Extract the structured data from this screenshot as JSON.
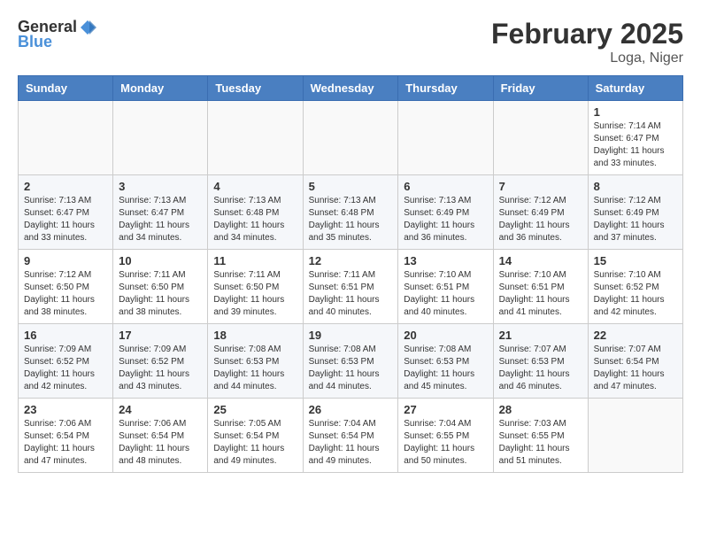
{
  "header": {
    "logo_general": "General",
    "logo_blue": "Blue",
    "month_title": "February 2025",
    "location": "Loga, Niger"
  },
  "weekdays": [
    "Sunday",
    "Monday",
    "Tuesday",
    "Wednesday",
    "Thursday",
    "Friday",
    "Saturday"
  ],
  "weeks": [
    [
      {
        "day": "",
        "info": ""
      },
      {
        "day": "",
        "info": ""
      },
      {
        "day": "",
        "info": ""
      },
      {
        "day": "",
        "info": ""
      },
      {
        "day": "",
        "info": ""
      },
      {
        "day": "",
        "info": ""
      },
      {
        "day": "1",
        "info": "Sunrise: 7:14 AM\nSunset: 6:47 PM\nDaylight: 11 hours and 33 minutes."
      }
    ],
    [
      {
        "day": "2",
        "info": "Sunrise: 7:13 AM\nSunset: 6:47 PM\nDaylight: 11 hours and 33 minutes."
      },
      {
        "day": "3",
        "info": "Sunrise: 7:13 AM\nSunset: 6:47 PM\nDaylight: 11 hours and 34 minutes."
      },
      {
        "day": "4",
        "info": "Sunrise: 7:13 AM\nSunset: 6:48 PM\nDaylight: 11 hours and 34 minutes."
      },
      {
        "day": "5",
        "info": "Sunrise: 7:13 AM\nSunset: 6:48 PM\nDaylight: 11 hours and 35 minutes."
      },
      {
        "day": "6",
        "info": "Sunrise: 7:13 AM\nSunset: 6:49 PM\nDaylight: 11 hours and 36 minutes."
      },
      {
        "day": "7",
        "info": "Sunrise: 7:12 AM\nSunset: 6:49 PM\nDaylight: 11 hours and 36 minutes."
      },
      {
        "day": "8",
        "info": "Sunrise: 7:12 AM\nSunset: 6:49 PM\nDaylight: 11 hours and 37 minutes."
      }
    ],
    [
      {
        "day": "9",
        "info": "Sunrise: 7:12 AM\nSunset: 6:50 PM\nDaylight: 11 hours and 38 minutes."
      },
      {
        "day": "10",
        "info": "Sunrise: 7:11 AM\nSunset: 6:50 PM\nDaylight: 11 hours and 38 minutes."
      },
      {
        "day": "11",
        "info": "Sunrise: 7:11 AM\nSunset: 6:50 PM\nDaylight: 11 hours and 39 minutes."
      },
      {
        "day": "12",
        "info": "Sunrise: 7:11 AM\nSunset: 6:51 PM\nDaylight: 11 hours and 40 minutes."
      },
      {
        "day": "13",
        "info": "Sunrise: 7:10 AM\nSunset: 6:51 PM\nDaylight: 11 hours and 40 minutes."
      },
      {
        "day": "14",
        "info": "Sunrise: 7:10 AM\nSunset: 6:51 PM\nDaylight: 11 hours and 41 minutes."
      },
      {
        "day": "15",
        "info": "Sunrise: 7:10 AM\nSunset: 6:52 PM\nDaylight: 11 hours and 42 minutes."
      }
    ],
    [
      {
        "day": "16",
        "info": "Sunrise: 7:09 AM\nSunset: 6:52 PM\nDaylight: 11 hours and 42 minutes."
      },
      {
        "day": "17",
        "info": "Sunrise: 7:09 AM\nSunset: 6:52 PM\nDaylight: 11 hours and 43 minutes."
      },
      {
        "day": "18",
        "info": "Sunrise: 7:08 AM\nSunset: 6:53 PM\nDaylight: 11 hours and 44 minutes."
      },
      {
        "day": "19",
        "info": "Sunrise: 7:08 AM\nSunset: 6:53 PM\nDaylight: 11 hours and 44 minutes."
      },
      {
        "day": "20",
        "info": "Sunrise: 7:08 AM\nSunset: 6:53 PM\nDaylight: 11 hours and 45 minutes."
      },
      {
        "day": "21",
        "info": "Sunrise: 7:07 AM\nSunset: 6:53 PM\nDaylight: 11 hours and 46 minutes."
      },
      {
        "day": "22",
        "info": "Sunrise: 7:07 AM\nSunset: 6:54 PM\nDaylight: 11 hours and 47 minutes."
      }
    ],
    [
      {
        "day": "23",
        "info": "Sunrise: 7:06 AM\nSunset: 6:54 PM\nDaylight: 11 hours and 47 minutes."
      },
      {
        "day": "24",
        "info": "Sunrise: 7:06 AM\nSunset: 6:54 PM\nDaylight: 11 hours and 48 minutes."
      },
      {
        "day": "25",
        "info": "Sunrise: 7:05 AM\nSunset: 6:54 PM\nDaylight: 11 hours and 49 minutes."
      },
      {
        "day": "26",
        "info": "Sunrise: 7:04 AM\nSunset: 6:54 PM\nDaylight: 11 hours and 49 minutes."
      },
      {
        "day": "27",
        "info": "Sunrise: 7:04 AM\nSunset: 6:55 PM\nDaylight: 11 hours and 50 minutes."
      },
      {
        "day": "28",
        "info": "Sunrise: 7:03 AM\nSunset: 6:55 PM\nDaylight: 11 hours and 51 minutes."
      },
      {
        "day": "",
        "info": ""
      }
    ]
  ]
}
